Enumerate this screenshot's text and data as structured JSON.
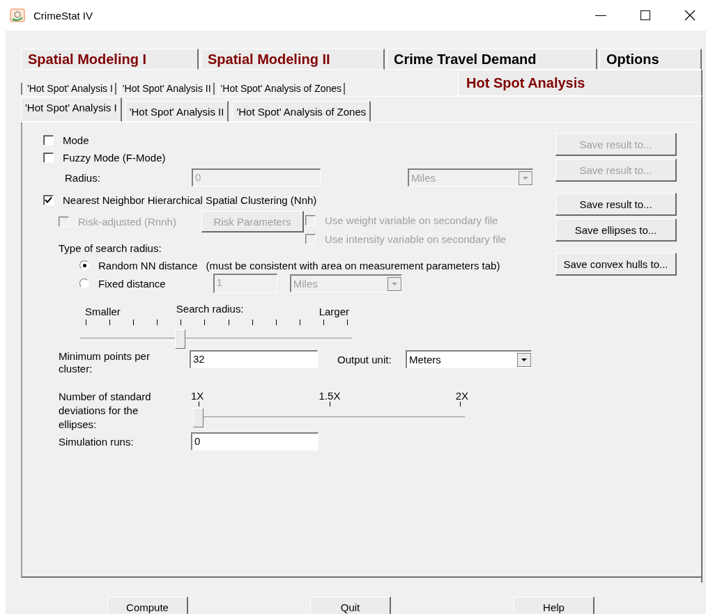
{
  "window": {
    "title": "CrimeStat IV"
  },
  "main_tabs": [
    {
      "label": "Spatial Modeling I",
      "selected": false,
      "color": "#800000"
    },
    {
      "label": "Spatial Modeling II",
      "selected": false,
      "color": "#800000"
    },
    {
      "label": "Crime Travel Demand",
      "selected": false,
      "color": "#000000"
    },
    {
      "label": "Options",
      "selected": false,
      "color": "#000000"
    },
    {
      "label": "Hot Spot Analysis",
      "selected": true,
      "color": "#800000"
    }
  ],
  "overlay_sub_tabs": [
    "'Hot Spot' Analysis I",
    "'Hot Spot' Analysis II",
    "'Hot Spot' Analysis of Zones"
  ],
  "sub_tabs": [
    {
      "label": "'Hot Spot' Analysis I",
      "selected": true
    },
    {
      "label": "'Hot Spot' Analysis II",
      "selected": false
    },
    {
      "label": "'Hot Spot' Analysis of Zones",
      "selected": false
    }
  ],
  "mode": {
    "label": "Mode",
    "checked": false
  },
  "fuzzy_mode": {
    "label": "Fuzzy Mode (F-Mode)",
    "checked": false
  },
  "radius": {
    "label": "Radius:",
    "value": "0",
    "unit": "Miles",
    "disabled": true
  },
  "nnh": {
    "label": "Nearest Neighbor Hierarchical Spatial Clustering (Nnh)",
    "checked": true
  },
  "risk_adjusted": {
    "label": "Risk-adjusted (Rnnh)",
    "checked": false,
    "disabled": true
  },
  "risk_parameters_button": {
    "label": "Risk Parameters",
    "disabled": true
  },
  "secondary_options": [
    {
      "label": "Use weight variable on secondary file",
      "checked": false,
      "disabled": true
    },
    {
      "label": "Use intensity variable on secondary file",
      "checked": false,
      "disabled": true
    }
  ],
  "search_radius_type": {
    "label": "Type of search radius:",
    "options": [
      {
        "label": "Random NN distance",
        "selected": true,
        "note": "(must be consistent with area on measurement parameters tab)"
      },
      {
        "label": "Fixed distance",
        "selected": false
      }
    ]
  },
  "fixed_distance": {
    "value": "1",
    "unit": "Miles",
    "disabled": true
  },
  "search_radius_slider": {
    "title": "Search radius:",
    "min_label": "Smaller",
    "max_label": "Larger",
    "level": 0.3636
  },
  "min_points": {
    "label": "Minimum points per cluster:",
    "value": "32"
  },
  "output_unit": {
    "label": "Output unit:",
    "value": "Meters"
  },
  "std_dev_slider": {
    "label": "Number of standard deviations for the ellipses:",
    "ticks": [
      "1X",
      "1.5X",
      "2X"
    ],
    "level": 0
  },
  "simulation_runs": {
    "label": "Simulation runs:",
    "value": "0"
  },
  "save_buttons": [
    {
      "label": "Save result to...",
      "disabled": true
    },
    {
      "label": "Save result to...",
      "disabled": true
    },
    {
      "label": "Save result to...",
      "disabled": false
    },
    {
      "label": "Save ellipses to...",
      "disabled": false
    },
    {
      "label": "Save convex hulls to...",
      "disabled": false
    }
  ],
  "bottom_buttons": [
    "Compute",
    "Quit",
    "Help"
  ]
}
